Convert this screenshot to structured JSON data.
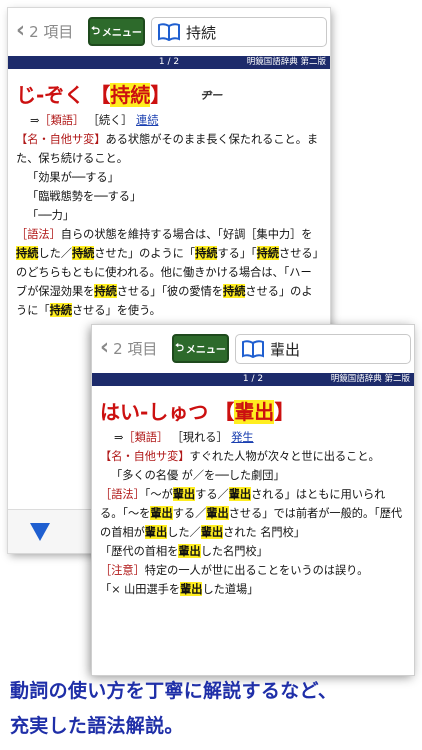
{
  "panel1": {
    "back_label": "2 項目",
    "menu_label": "メニュー",
    "search_term": "持続",
    "page": "1 / 2",
    "dictionary": "明鏡国語辞典 第二版",
    "headword_kana": "じ-ぞく",
    "headword_kanji": "持続",
    "accent": "ヂー",
    "syn_arrow": "⇒",
    "syn_label1": "［類語］",
    "syn_term1": "［続く］",
    "syn_link": "連続",
    "def_pos": "【名・自他サ変】",
    "def_text": "ある状態がそのまま長く保たれること。また、保ち続けること。",
    "ex1": "「効果が──する」",
    "ex2": "「臨戦態勢を──する」",
    "ex3": "「──力」",
    "usage_label": "［語法］",
    "usage_a": "自らの状態を維持する場合は、「好調［集中力］を",
    "usage_hl1": "持続",
    "usage_b": "した／",
    "usage_hl2": "持続",
    "usage_c": "させた」のように「",
    "usage_hl3": "持続",
    "usage_d": "する」「",
    "usage_hl4": "持続",
    "usage_e": "させる」のどちらもともに使われる。他に働きかける場合は、「ハーブが保湿効果を",
    "usage_hl5": "持続",
    "usage_f": "させる」「彼の愛情を",
    "usage_hl6": "持続",
    "usage_g": "させる」のように「",
    "usage_hl7": "持続",
    "usage_h": "させる」を使う。"
  },
  "panel2": {
    "back_label": "2 項目",
    "menu_label": "メニュー",
    "search_term": "輩出",
    "page": "1 / 2",
    "dictionary": "明鏡国語辞典 第二版",
    "headword_kana": "はい-しゅつ",
    "headword_kanji": "輩出",
    "syn_arrow": "⇒",
    "syn_label1": "［類語］",
    "syn_term1": "［現れる］",
    "syn_link": "発生",
    "def_pos": "【名・自他サ変】",
    "def_text": "すぐれた人物が次々と世に出ること。",
    "ex1": "「多くの名優 が／を──した劇団」",
    "usage_label": "［語法］",
    "usage_a": "「〜が",
    "usage_hl1": "輩出",
    "usage_b": "する／",
    "usage_hl2": "輩出",
    "usage_c": "される」はともに用いられる。「〜を",
    "usage_hl3": "輩出",
    "usage_d": "する／",
    "usage_hl4": "輩出",
    "usage_e": "させる」では前者が一般的。「歴代の首相が",
    "usage_hl5": "輩出",
    "usage_f": "した／",
    "usage_hl6": "輩出",
    "usage_g": "された 名門校」",
    "ex2a": "「歴代の首相を",
    "ex2hl": "輩出",
    "ex2b": "した名門校」",
    "note_label": "［注意］",
    "note_text": "特定の一人が世に出ることをいうのは誤り。",
    "ex3a": "「× 山田選手を",
    "ex3hl": "輩出",
    "ex3b": "した道場」"
  },
  "caption_line1": "動詞の使い方を丁寧に解説するなど、",
  "caption_line2": "充実した語法解説。"
}
